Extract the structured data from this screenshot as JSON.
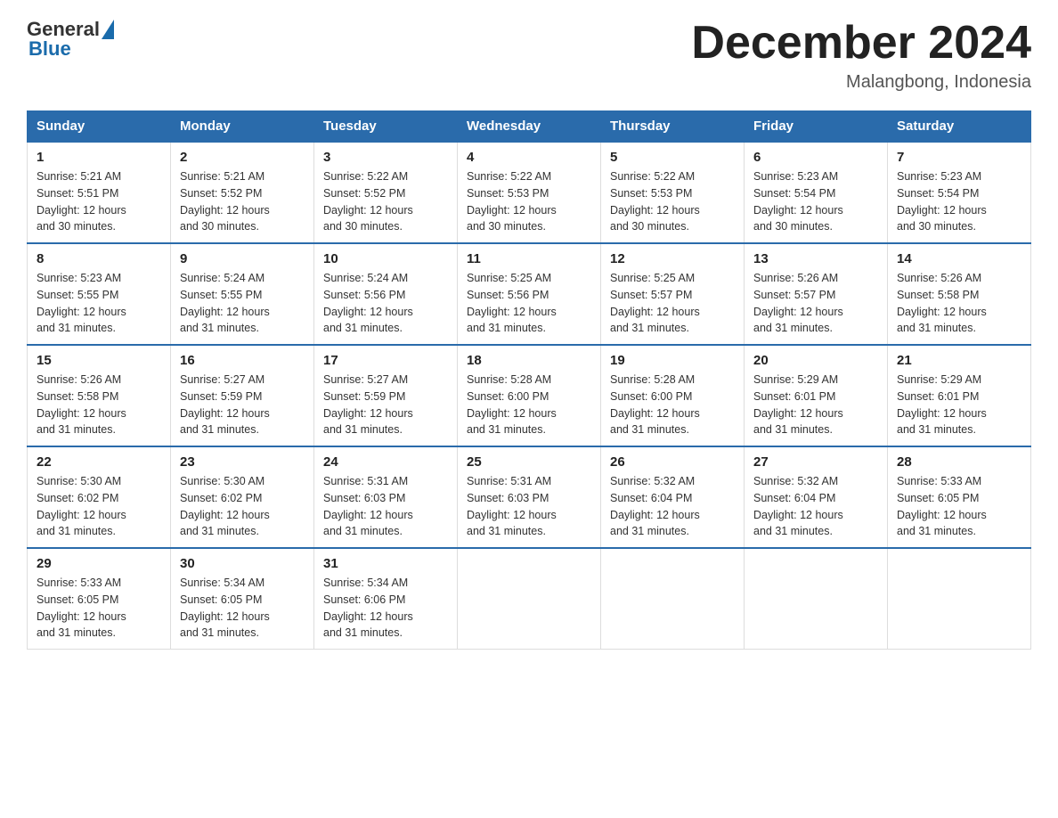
{
  "header": {
    "logo_general": "General",
    "logo_blue": "Blue",
    "month_title": "December 2024",
    "location": "Malangbong, Indonesia"
  },
  "calendar": {
    "days_of_week": [
      "Sunday",
      "Monday",
      "Tuesday",
      "Wednesday",
      "Thursday",
      "Friday",
      "Saturday"
    ],
    "weeks": [
      [
        {
          "day": "1",
          "sunrise": "5:21 AM",
          "sunset": "5:51 PM",
          "daylight": "12 hours and 30 minutes."
        },
        {
          "day": "2",
          "sunrise": "5:21 AM",
          "sunset": "5:52 PM",
          "daylight": "12 hours and 30 minutes."
        },
        {
          "day": "3",
          "sunrise": "5:22 AM",
          "sunset": "5:52 PM",
          "daylight": "12 hours and 30 minutes."
        },
        {
          "day": "4",
          "sunrise": "5:22 AM",
          "sunset": "5:53 PM",
          "daylight": "12 hours and 30 minutes."
        },
        {
          "day": "5",
          "sunrise": "5:22 AM",
          "sunset": "5:53 PM",
          "daylight": "12 hours and 30 minutes."
        },
        {
          "day": "6",
          "sunrise": "5:23 AM",
          "sunset": "5:54 PM",
          "daylight": "12 hours and 30 minutes."
        },
        {
          "day": "7",
          "sunrise": "5:23 AM",
          "sunset": "5:54 PM",
          "daylight": "12 hours and 30 minutes."
        }
      ],
      [
        {
          "day": "8",
          "sunrise": "5:23 AM",
          "sunset": "5:55 PM",
          "daylight": "12 hours and 31 minutes."
        },
        {
          "day": "9",
          "sunrise": "5:24 AM",
          "sunset": "5:55 PM",
          "daylight": "12 hours and 31 minutes."
        },
        {
          "day": "10",
          "sunrise": "5:24 AM",
          "sunset": "5:56 PM",
          "daylight": "12 hours and 31 minutes."
        },
        {
          "day": "11",
          "sunrise": "5:25 AM",
          "sunset": "5:56 PM",
          "daylight": "12 hours and 31 minutes."
        },
        {
          "day": "12",
          "sunrise": "5:25 AM",
          "sunset": "5:57 PM",
          "daylight": "12 hours and 31 minutes."
        },
        {
          "day": "13",
          "sunrise": "5:26 AM",
          "sunset": "5:57 PM",
          "daylight": "12 hours and 31 minutes."
        },
        {
          "day": "14",
          "sunrise": "5:26 AM",
          "sunset": "5:58 PM",
          "daylight": "12 hours and 31 minutes."
        }
      ],
      [
        {
          "day": "15",
          "sunrise": "5:26 AM",
          "sunset": "5:58 PM",
          "daylight": "12 hours and 31 minutes."
        },
        {
          "day": "16",
          "sunrise": "5:27 AM",
          "sunset": "5:59 PM",
          "daylight": "12 hours and 31 minutes."
        },
        {
          "day": "17",
          "sunrise": "5:27 AM",
          "sunset": "5:59 PM",
          "daylight": "12 hours and 31 minutes."
        },
        {
          "day": "18",
          "sunrise": "5:28 AM",
          "sunset": "6:00 PM",
          "daylight": "12 hours and 31 minutes."
        },
        {
          "day": "19",
          "sunrise": "5:28 AM",
          "sunset": "6:00 PM",
          "daylight": "12 hours and 31 minutes."
        },
        {
          "day": "20",
          "sunrise": "5:29 AM",
          "sunset": "6:01 PM",
          "daylight": "12 hours and 31 minutes."
        },
        {
          "day": "21",
          "sunrise": "5:29 AM",
          "sunset": "6:01 PM",
          "daylight": "12 hours and 31 minutes."
        }
      ],
      [
        {
          "day": "22",
          "sunrise": "5:30 AM",
          "sunset": "6:02 PM",
          "daylight": "12 hours and 31 minutes."
        },
        {
          "day": "23",
          "sunrise": "5:30 AM",
          "sunset": "6:02 PM",
          "daylight": "12 hours and 31 minutes."
        },
        {
          "day": "24",
          "sunrise": "5:31 AM",
          "sunset": "6:03 PM",
          "daylight": "12 hours and 31 minutes."
        },
        {
          "day": "25",
          "sunrise": "5:31 AM",
          "sunset": "6:03 PM",
          "daylight": "12 hours and 31 minutes."
        },
        {
          "day": "26",
          "sunrise": "5:32 AM",
          "sunset": "6:04 PM",
          "daylight": "12 hours and 31 minutes."
        },
        {
          "day": "27",
          "sunrise": "5:32 AM",
          "sunset": "6:04 PM",
          "daylight": "12 hours and 31 minutes."
        },
        {
          "day": "28",
          "sunrise": "5:33 AM",
          "sunset": "6:05 PM",
          "daylight": "12 hours and 31 minutes."
        }
      ],
      [
        {
          "day": "29",
          "sunrise": "5:33 AM",
          "sunset": "6:05 PM",
          "daylight": "12 hours and 31 minutes."
        },
        {
          "day": "30",
          "sunrise": "5:34 AM",
          "sunset": "6:05 PM",
          "daylight": "12 hours and 31 minutes."
        },
        {
          "day": "31",
          "sunrise": "5:34 AM",
          "sunset": "6:06 PM",
          "daylight": "12 hours and 31 minutes."
        },
        null,
        null,
        null,
        null
      ]
    ]
  },
  "labels": {
    "sunrise": "Sunrise:",
    "sunset": "Sunset:",
    "daylight": "Daylight:"
  }
}
